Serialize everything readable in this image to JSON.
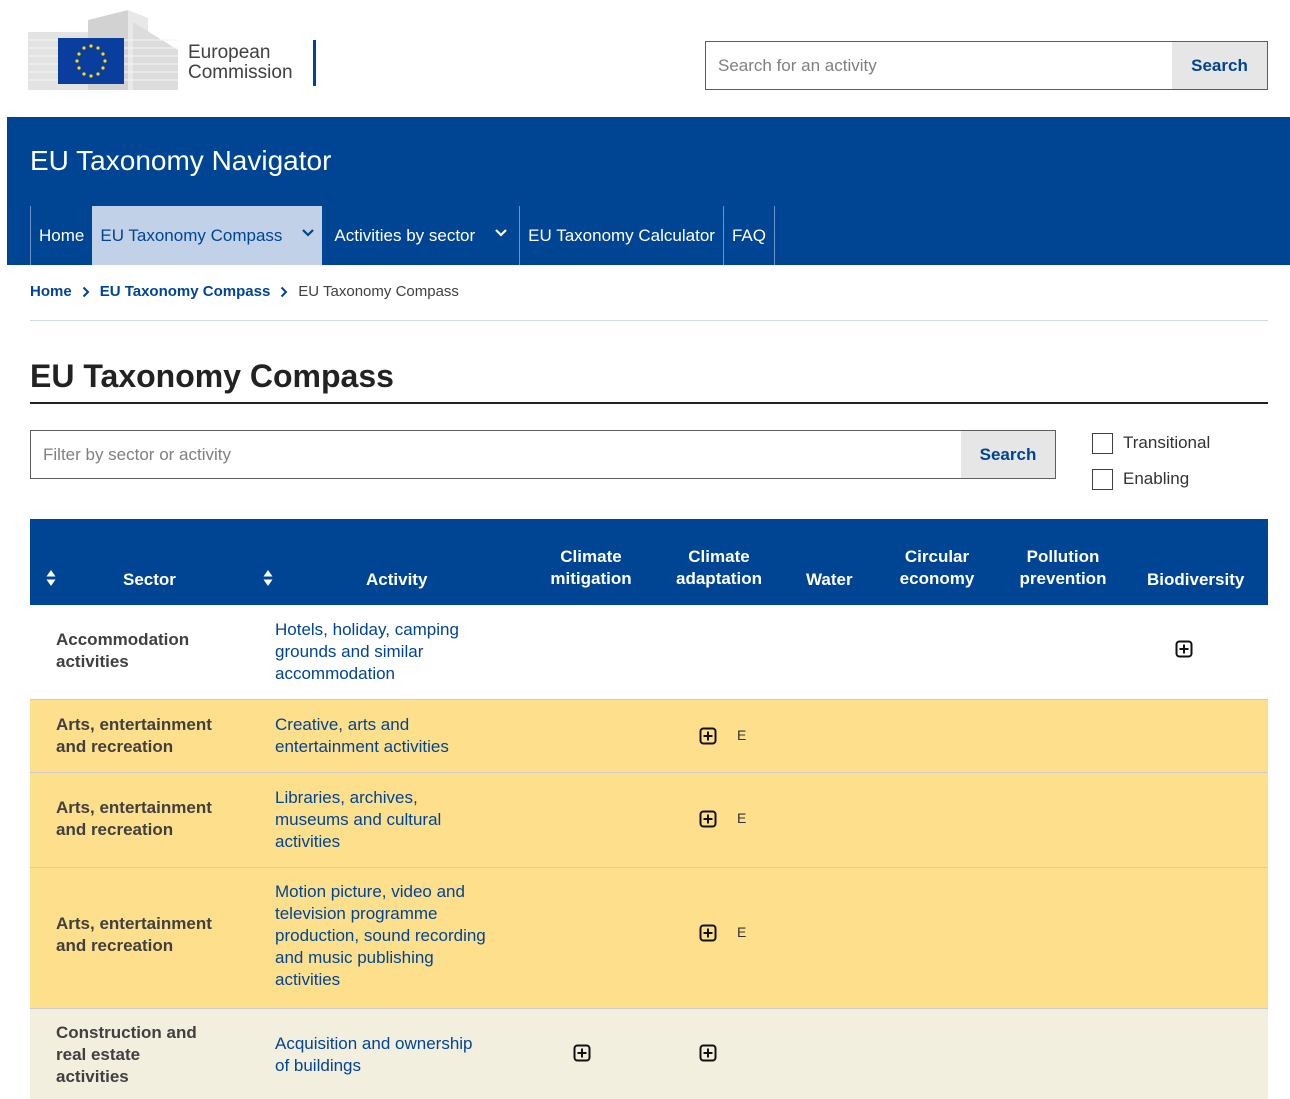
{
  "header": {
    "logo_line1": "European",
    "logo_line2": "Commission",
    "search_placeholder": "Search for an activity",
    "search_button": "Search"
  },
  "site_title": "EU Taxonomy Navigator",
  "nav": [
    {
      "label": "Home"
    },
    {
      "label": "EU Taxonomy Compass"
    },
    {
      "label": "Activities by sector"
    },
    {
      "label": "EU Taxonomy Calculator"
    },
    {
      "label": "FAQ"
    }
  ],
  "breadcrumb": [
    "Home",
    "EU Taxonomy Compass",
    "EU Taxonomy Compass"
  ],
  "page_title": "EU Taxonomy Compass",
  "filter": {
    "placeholder": "Filter by sector or activity",
    "button": "Search",
    "options": [
      "Transitional",
      "Enabling"
    ]
  },
  "table": {
    "columns": {
      "sector": "Sector",
      "activity": "Activity",
      "climate_mitigation": [
        "Climate",
        "mitigation"
      ],
      "climate_adaptation": [
        "Climate",
        "adaptation"
      ],
      "water": "Water",
      "circular_economy": [
        "Circular",
        "economy"
      ],
      "pollution_prevention": [
        "Pollution",
        "prevention"
      ],
      "biodiversity": "Biodiversity"
    },
    "rows": [
      {
        "sector": [
          "Accommodation",
          "activities"
        ],
        "activity": [
          "Hotels, holiday, camping",
          "grounds and similar",
          "accommodation"
        ],
        "color": "#ffffff",
        "mitigation": false,
        "adaptation": false,
        "adaptation_tag": "",
        "biodiversity": true
      },
      {
        "sector": [
          "Arts, entertainment",
          "and recreation"
        ],
        "activity": [
          "Creative, arts and",
          "entertainment activities"
        ],
        "color": "#fedf8c",
        "mitigation": false,
        "adaptation": true,
        "adaptation_tag": "E",
        "biodiversity": false
      },
      {
        "sector": [
          "Arts, entertainment",
          "and recreation"
        ],
        "activity": [
          "Libraries, archives,",
          "museums and cultural",
          "activities"
        ],
        "color": "#fedf8c",
        "mitigation": false,
        "adaptation": true,
        "adaptation_tag": "E",
        "biodiversity": false
      },
      {
        "sector": [
          "Arts, entertainment",
          "and recreation"
        ],
        "activity": [
          "Motion picture, video and",
          "television programme",
          "production, sound recording",
          "and music publishing",
          "activities"
        ],
        "color": "#fedf8c",
        "mitigation": false,
        "adaptation": true,
        "adaptation_tag": "E",
        "biodiversity": false
      },
      {
        "sector": [
          "Construction and",
          "real estate",
          "activities"
        ],
        "activity": [
          "Acquisition and ownership",
          "of buildings"
        ],
        "color": "#f3efdf",
        "mitigation": true,
        "adaptation": true,
        "adaptation_tag": "",
        "biodiversity": false
      }
    ]
  },
  "colors": {
    "primary": "#004494",
    "nav_active": "#c1d1e8",
    "row_yellow": "#fedf8c",
    "row_beige": "#f3efdf"
  }
}
